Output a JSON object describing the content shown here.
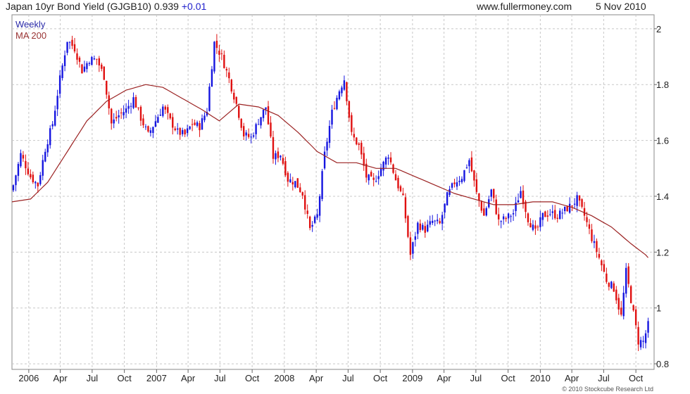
{
  "header": {
    "title": "Japan 10yr Bond Yield (GJGB10)",
    "last": "0.939",
    "change": "+0.01",
    "source": "www.fullermoney.com",
    "date": "5 Nov 2010"
  },
  "legend": [
    {
      "name": "Weekly",
      "color": "#2a2aa8"
    },
    {
      "name": "MA 200",
      "color": "#993333"
    }
  ],
  "copyright": "© 2010 Stockcube Research Ltd",
  "colors": {
    "up": "#1515e0",
    "down": "#e01010",
    "ma": "#9b2222",
    "grid": "#c8c8c8"
  },
  "chart_data": {
    "type": "candlestick",
    "grid": "dashed",
    "ylim": [
      0.78,
      2.05
    ],
    "yticks": [
      0.8,
      1,
      1.2,
      1.4,
      1.6,
      1.8,
      2
    ],
    "ytick_labels": [
      "0.8",
      "1",
      "1.2",
      "1.4",
      "1.6",
      "1.8",
      "2"
    ],
    "xlim": [
      "2005-11-14",
      "2010-11-22"
    ],
    "xticks": [
      {
        "label": "2006",
        "date": "2006-01-01"
      },
      {
        "label": "Apr",
        "date": "2006-04-01"
      },
      {
        "label": "Jul",
        "date": "2006-07-01"
      },
      {
        "label": "Oct",
        "date": "2006-10-01"
      },
      {
        "label": "2007",
        "date": "2007-01-01"
      },
      {
        "label": "Apr",
        "date": "2007-04-01"
      },
      {
        "label": "Jul",
        "date": "2007-07-01"
      },
      {
        "label": "Oct",
        "date": "2007-10-01"
      },
      {
        "label": "2008",
        "date": "2008-01-01"
      },
      {
        "label": "Apr",
        "date": "2008-04-01"
      },
      {
        "label": "Jul",
        "date": "2008-07-01"
      },
      {
        "label": "Oct",
        "date": "2008-10-01"
      },
      {
        "label": "2009",
        "date": "2009-01-01"
      },
      {
        "label": "Apr",
        "date": "2009-04-01"
      },
      {
        "label": "Jul",
        "date": "2009-07-01"
      },
      {
        "label": "Oct",
        "date": "2009-10-01"
      },
      {
        "label": "2010",
        "date": "2010-01-01"
      },
      {
        "label": "Apr",
        "date": "2010-04-01"
      },
      {
        "label": "Jul",
        "date": "2010-07-01"
      },
      {
        "label": "Oct",
        "date": "2010-10-01"
      }
    ],
    "close_anchors": [
      [
        "2005-11-18",
        1.44
      ],
      [
        "2005-12-09",
        1.55
      ],
      [
        "2006-01-06",
        1.47
      ],
      [
        "2006-01-27",
        1.44
      ],
      [
        "2006-02-17",
        1.57
      ],
      [
        "2006-03-10",
        1.66
      ],
      [
        "2006-03-31",
        1.82
      ],
      [
        "2006-04-21",
        1.96
      ],
      [
        "2006-05-12",
        1.93
      ],
      [
        "2006-06-02",
        1.85
      ],
      [
        "2006-06-23",
        1.89
      ],
      [
        "2006-07-14",
        1.89
      ],
      [
        "2006-08-04",
        1.83
      ],
      [
        "2006-08-25",
        1.66
      ],
      [
        "2006-09-15",
        1.69
      ],
      [
        "2006-10-06",
        1.71
      ],
      [
        "2006-10-27",
        1.75
      ],
      [
        "2006-11-17",
        1.68
      ],
      [
        "2006-12-08",
        1.62
      ],
      [
        "2006-12-29",
        1.67
      ],
      [
        "2007-01-19",
        1.72
      ],
      [
        "2007-02-09",
        1.67
      ],
      [
        "2007-03-02",
        1.63
      ],
      [
        "2007-03-23",
        1.62
      ],
      [
        "2007-04-13",
        1.66
      ],
      [
        "2007-05-04",
        1.65
      ],
      [
        "2007-05-25",
        1.71
      ],
      [
        "2007-06-15",
        1.95
      ],
      [
        "2007-07-06",
        1.9
      ],
      [
        "2007-07-27",
        1.82
      ],
      [
        "2007-08-17",
        1.73
      ],
      [
        "2007-09-07",
        1.62
      ],
      [
        "2007-09-28",
        1.61
      ],
      [
        "2007-10-19",
        1.67
      ],
      [
        "2007-11-09",
        1.72
      ],
      [
        "2007-11-30",
        1.54
      ],
      [
        "2007-12-21",
        1.55
      ],
      [
        "2008-01-11",
        1.46
      ],
      [
        "2008-02-01",
        1.45
      ],
      [
        "2008-02-22",
        1.41
      ],
      [
        "2008-03-14",
        1.28
      ],
      [
        "2008-04-04",
        1.33
      ],
      [
        "2008-04-25",
        1.55
      ],
      [
        "2008-05-16",
        1.7
      ],
      [
        "2008-06-06",
        1.78
      ],
      [
        "2008-06-20",
        1.82
      ],
      [
        "2008-07-11",
        1.62
      ],
      [
        "2008-08-01",
        1.58
      ],
      [
        "2008-08-22",
        1.47
      ],
      [
        "2008-09-12",
        1.45
      ],
      [
        "2008-10-03",
        1.5
      ],
      [
        "2008-10-24",
        1.55
      ],
      [
        "2008-11-14",
        1.46
      ],
      [
        "2008-12-05",
        1.39
      ],
      [
        "2008-12-26",
        1.19
      ],
      [
        "2009-01-16",
        1.3
      ],
      [
        "2009-02-06",
        1.28
      ],
      [
        "2009-02-27",
        1.31
      ],
      [
        "2009-03-20",
        1.3
      ],
      [
        "2009-04-10",
        1.4
      ],
      [
        "2009-05-01",
        1.45
      ],
      [
        "2009-05-22",
        1.47
      ],
      [
        "2009-06-12",
        1.53
      ],
      [
        "2009-07-03",
        1.41
      ],
      [
        "2009-07-24",
        1.33
      ],
      [
        "2009-08-14",
        1.42
      ],
      [
        "2009-09-04",
        1.31
      ],
      [
        "2009-09-25",
        1.32
      ],
      [
        "2009-10-16",
        1.34
      ],
      [
        "2009-11-06",
        1.42
      ],
      [
        "2009-11-27",
        1.32
      ],
      [
        "2009-12-18",
        1.27
      ],
      [
        "2010-01-08",
        1.33
      ],
      [
        "2010-01-29",
        1.34
      ],
      [
        "2010-02-19",
        1.33
      ],
      [
        "2010-03-12",
        1.35
      ],
      [
        "2010-04-02",
        1.37
      ],
      [
        "2010-04-16",
        1.39
      ],
      [
        "2010-05-07",
        1.33
      ],
      [
        "2010-05-28",
        1.25
      ],
      [
        "2010-06-18",
        1.18
      ],
      [
        "2010-07-09",
        1.1
      ],
      [
        "2010-07-30",
        1.07
      ],
      [
        "2010-08-20",
        0.97
      ],
      [
        "2010-09-03",
        1.13
      ],
      [
        "2010-09-24",
        0.98
      ],
      [
        "2010-10-08",
        0.88
      ],
      [
        "2010-10-22",
        0.88
      ],
      [
        "2010-11-05",
        0.939
      ]
    ],
    "ma200_anchors": [
      [
        "2005-11-14",
        1.38
      ],
      [
        "2006-01-06",
        1.39
      ],
      [
        "2006-02-24",
        1.45
      ],
      [
        "2006-04-21",
        1.56
      ],
      [
        "2006-06-16",
        1.67
      ],
      [
        "2006-08-11",
        1.74
      ],
      [
        "2006-10-06",
        1.78
      ],
      [
        "2006-12-01",
        1.8
      ],
      [
        "2007-01-19",
        1.79
      ],
      [
        "2007-03-16",
        1.75
      ],
      [
        "2007-05-11",
        1.71
      ],
      [
        "2007-06-29",
        1.67
      ],
      [
        "2007-08-24",
        1.73
      ],
      [
        "2007-10-19",
        1.72
      ],
      [
        "2007-12-14",
        1.69
      ],
      [
        "2008-02-08",
        1.63
      ],
      [
        "2008-04-04",
        1.56
      ],
      [
        "2008-05-30",
        1.52
      ],
      [
        "2008-07-25",
        1.52
      ],
      [
        "2008-09-19",
        1.5
      ],
      [
        "2008-11-14",
        1.5
      ],
      [
        "2009-01-09",
        1.47
      ],
      [
        "2009-03-06",
        1.44
      ],
      [
        "2009-05-01",
        1.41
      ],
      [
        "2009-06-26",
        1.39
      ],
      [
        "2009-08-21",
        1.37
      ],
      [
        "2009-10-16",
        1.37
      ],
      [
        "2009-12-11",
        1.38
      ],
      [
        "2010-02-05",
        1.38
      ],
      [
        "2010-04-02",
        1.36
      ],
      [
        "2010-05-28",
        1.33
      ],
      [
        "2010-07-23",
        1.29
      ],
      [
        "2010-09-17",
        1.23
      ],
      [
        "2010-10-29",
        1.19
      ],
      [
        "2010-11-05",
        1.18
      ]
    ],
    "weekly_range": 0.05
  }
}
